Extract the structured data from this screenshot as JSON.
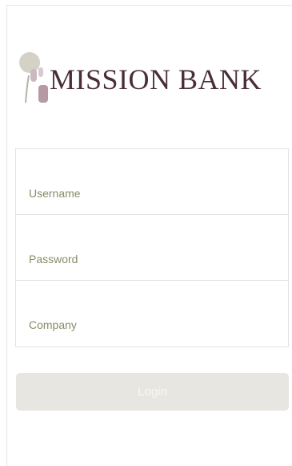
{
  "brand": {
    "logo_icon": "mission-bank-mark-icon",
    "name": "MISSION BANK",
    "text_color": "#4a2d3a"
  },
  "form": {
    "username_placeholder": "Username",
    "username_value": "",
    "password_placeholder": "Password",
    "password_value": "",
    "company_placeholder": "Company",
    "company_value": "",
    "placeholder_color": "#8a8a6a"
  },
  "actions": {
    "login_label": "Login",
    "login_bg": "#e7e6e1"
  }
}
